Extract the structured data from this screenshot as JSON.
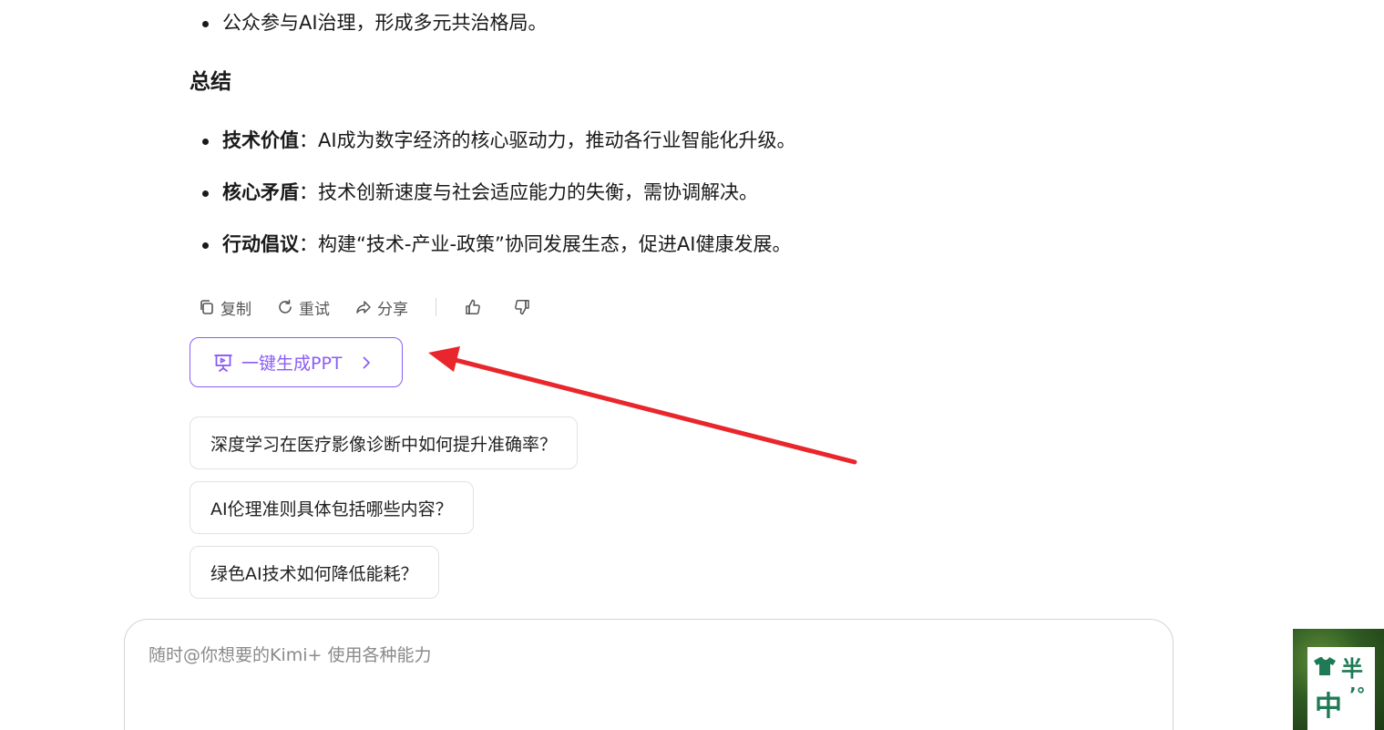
{
  "top_list": [
    {
      "text": "公众参与AI治理，形成多元共治格局。"
    }
  ],
  "summary": {
    "heading": "总结",
    "items": [
      {
        "label": "技术价值",
        "sep": "：",
        "text": "AI成为数字经济的核心驱动力，推动各行业智能化升级。"
      },
      {
        "label": "核心矛盾",
        "sep": "：",
        "text": "技术创新速度与社会适应能力的失衡，需协调解决。"
      },
      {
        "label": "行动倡议",
        "sep": "：",
        "text": "构建“技术-产业-政策”协同发展生态，促进AI健康发展。"
      }
    ]
  },
  "actions": {
    "copy": "复制",
    "retry": "重试",
    "share": "分享"
  },
  "ppt_button": {
    "label": "一键生成PPT",
    "color": "#8b5cf6"
  },
  "suggestions": [
    "深度学习在医疗影像诊断中如何提升准确率？",
    "AI伦理准则具体包括哪些内容？",
    "绿色AI技术如何降低能耗？"
  ],
  "chat_input": {
    "placeholder": "随时@你想要的Kimi+ 使用各种能力"
  },
  "corner_widget": {
    "line1": "半",
    "line2": "中",
    "mark": "’°",
    "color": "#1f7a55"
  },
  "annotation": {
    "arrow_color": "#e8262b"
  }
}
